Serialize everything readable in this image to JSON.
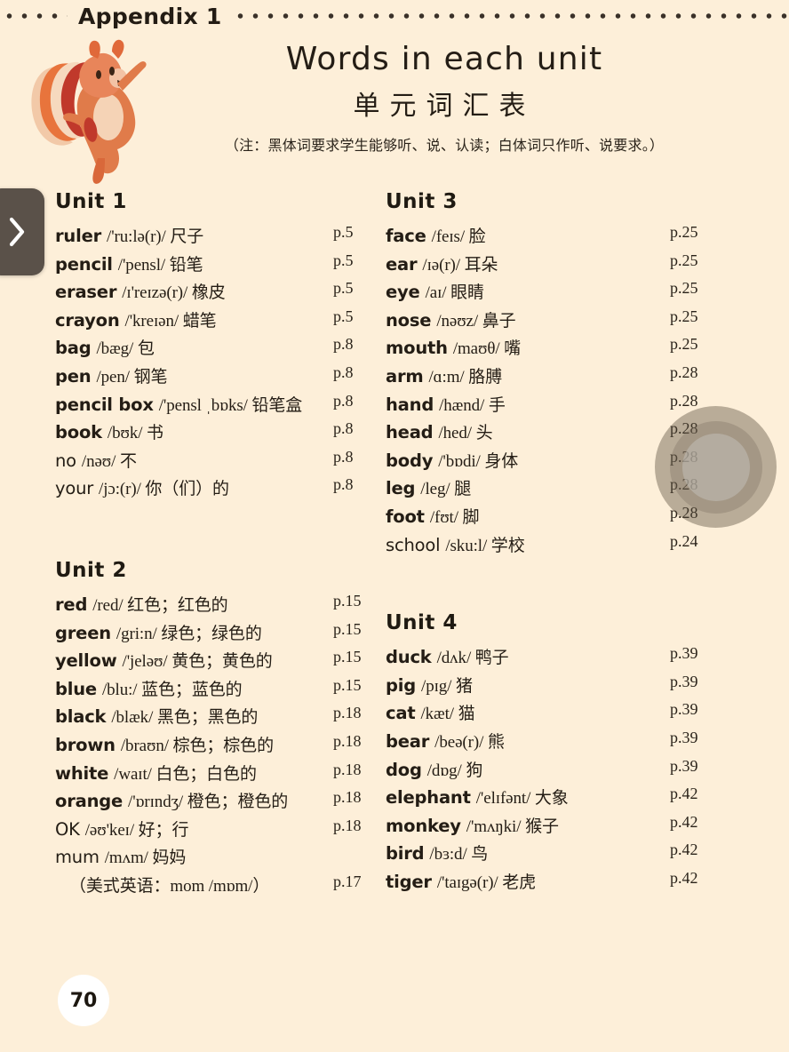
{
  "header": {
    "appendix_label": "Appendix 1",
    "title_en": "Words in each unit",
    "title_cn": "单元词汇表",
    "note": "（注：黑体词要求学生能够听、说、认读；白体词只作听、说要求。）"
  },
  "nav": {
    "next_arrow": "›"
  },
  "page_badge": {
    "number": "70"
  },
  "colors": {
    "background": "#FDEFD9",
    "text": "#241D15",
    "nav_button": "#5A5149",
    "badge_background": "#FFFFFF"
  },
  "units": [
    {
      "id": "unit-1",
      "title": "Unit 1",
      "entries": [
        {
          "word": "ruler",
          "rest": "/'ru:lə(r)/ 尺子",
          "page": "p.5",
          "bold": true
        },
        {
          "word": "pencil",
          "rest": "/'pensl/ 铅笔",
          "page": "p.5",
          "bold": true
        },
        {
          "word": "eraser",
          "rest": "/ɪ'reɪzə(r)/ 橡皮",
          "page": "p.5",
          "bold": true
        },
        {
          "word": "crayon",
          "rest": "/'kreɪən/ 蜡笔",
          "page": "p.5",
          "bold": true
        },
        {
          "word": "bag",
          "rest": "/bæg/ 包",
          "page": "p.8",
          "bold": true
        },
        {
          "word": "pen",
          "rest": "/pen/ 钢笔",
          "page": "p.8",
          "bold": true
        },
        {
          "word": "pencil box",
          "rest": "/'pensl ˌbɒks/ 铅笔盒",
          "page": "p.8",
          "bold": true
        },
        {
          "word": "book",
          "rest": "/bʊk/ 书",
          "page": "p.8",
          "bold": true
        },
        {
          "word": "no",
          "rest": "/nəʊ/ 不",
          "page": "p.8",
          "bold": false
        },
        {
          "word": "your",
          "rest": "/jɔ:(r)/ 你（们）的",
          "page": "p.8",
          "bold": false
        }
      ]
    },
    {
      "id": "unit-2",
      "title": "Unit 2",
      "entries": [
        {
          "word": "red",
          "rest": "/red/ 红色；红色的",
          "page": "p.15",
          "bold": true
        },
        {
          "word": "green",
          "rest": "/gri:n/ 绿色；绿色的",
          "page": "p.15",
          "bold": true
        },
        {
          "word": "yellow",
          "rest": "/'jeləʊ/ 黄色；黄色的",
          "page": "p.15",
          "bold": true
        },
        {
          "word": "blue",
          "rest": "/blu:/ 蓝色；蓝色的",
          "page": "p.15",
          "bold": true
        },
        {
          "word": "black",
          "rest": "/blæk/ 黑色；黑色的",
          "page": "p.18",
          "bold": true
        },
        {
          "word": "brown",
          "rest": "/braʊn/ 棕色；棕色的",
          "page": "p.18",
          "bold": true
        },
        {
          "word": "white",
          "rest": "/waɪt/ 白色；白色的",
          "page": "p.18",
          "bold": true
        },
        {
          "word": "orange",
          "rest": "/'ɒrɪndʒ/ 橙色；橙色的",
          "page": "p.18",
          "bold": true
        },
        {
          "word": "OK",
          "rest": "/əʊ'keɪ/ 好；行",
          "page": "p.18",
          "bold": false
        },
        {
          "word": "mum",
          "rest": "/mʌm/ 妈妈",
          "page": "",
          "bold": false
        },
        {
          "word": "",
          "rest": "（美式英语：mom /mɒm/）",
          "page": "p.17",
          "bold": false,
          "continuation": true
        }
      ]
    },
    {
      "id": "unit-3",
      "title": "Unit 3",
      "entries": [
        {
          "word": "face",
          "rest": "/feɪs/ 脸",
          "page": "p.25",
          "bold": true
        },
        {
          "word": "ear",
          "rest": "/ɪə(r)/ 耳朵",
          "page": "p.25",
          "bold": true
        },
        {
          "word": "eye",
          "rest": "/aɪ/ 眼睛",
          "page": "p.25",
          "bold": true
        },
        {
          "word": "nose",
          "rest": "/nəʊz/ 鼻子",
          "page": "p.25",
          "bold": true
        },
        {
          "word": "mouth",
          "rest": "/maʊθ/ 嘴",
          "page": "p.25",
          "bold": true
        },
        {
          "word": "arm",
          "rest": "/ɑ:m/ 胳膊",
          "page": "p.28",
          "bold": true
        },
        {
          "word": "hand",
          "rest": "/hænd/ 手",
          "page": "p.28",
          "bold": true
        },
        {
          "word": "head",
          "rest": "/hed/ 头",
          "page": "p.28",
          "bold": true
        },
        {
          "word": "body",
          "rest": "/'bɒdi/ 身体",
          "page": "p.28",
          "bold": true
        },
        {
          "word": "leg",
          "rest": "/leg/ 腿",
          "page": "p.28",
          "bold": true
        },
        {
          "word": "foot",
          "rest": "/fʊt/ 脚",
          "page": "p.28",
          "bold": true
        },
        {
          "word": "school",
          "rest": "/sku:l/ 学校",
          "page": "p.24",
          "bold": false
        }
      ]
    },
    {
      "id": "unit-4",
      "title": "Unit 4",
      "entries": [
        {
          "word": "duck",
          "rest": "/dʌk/ 鸭子",
          "page": "p.39",
          "bold": true
        },
        {
          "word": "pig",
          "rest": "/pɪg/ 猪",
          "page": "p.39",
          "bold": true
        },
        {
          "word": "cat",
          "rest": "/kæt/ 猫",
          "page": "p.39",
          "bold": true
        },
        {
          "word": "bear",
          "rest": "/beə(r)/ 熊",
          "page": "p.39",
          "bold": true
        },
        {
          "word": "dog",
          "rest": "/dɒg/ 狗",
          "page": "p.39",
          "bold": true
        },
        {
          "word": "elephant",
          "rest": "/'elɪfənt/ 大象",
          "page": "p.42",
          "bold": true
        },
        {
          "word": "monkey",
          "rest": "/'mʌŋki/ 猴子",
          "page": "p.42",
          "bold": true
        },
        {
          "word": "bird",
          "rest": "/bɜ:d/ 鸟",
          "page": "p.42",
          "bold": true
        },
        {
          "word": "tiger",
          "rest": "/'taɪgə(r)/ 老虎",
          "page": "p.42",
          "bold": true
        }
      ]
    }
  ]
}
